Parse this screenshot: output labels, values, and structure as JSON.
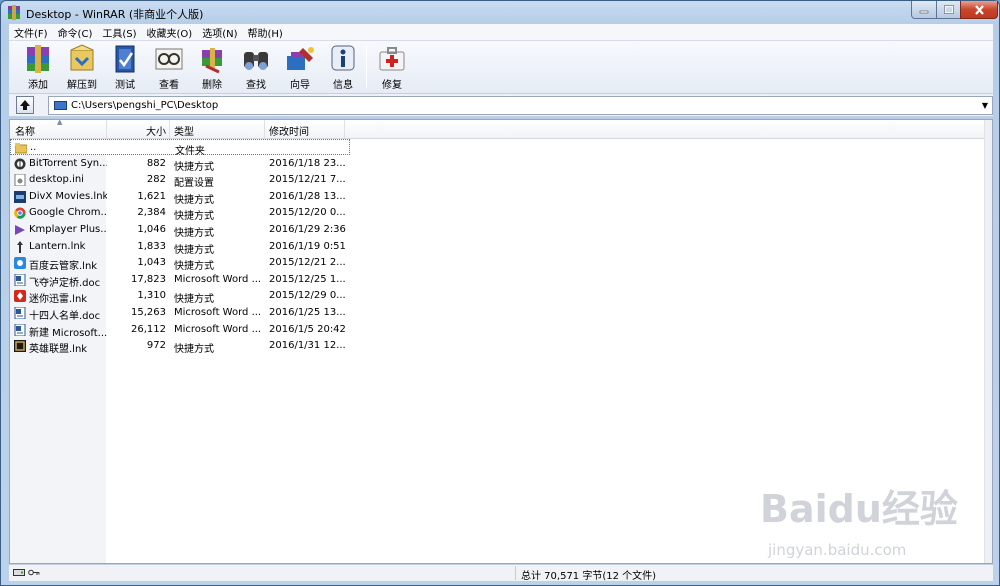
{
  "window": {
    "title": "Desktop - WinRAR (非商业个人版)"
  },
  "menu": [
    "文件(F)",
    "命令(C)",
    "工具(S)",
    "收藏夹(O)",
    "选项(N)",
    "帮助(H)"
  ],
  "toolbar": {
    "buttons": [
      "添加",
      "解压到",
      "测试",
      "查看",
      "删除",
      "查找",
      "向导",
      "信息",
      "修复"
    ]
  },
  "address": {
    "path": "C:\\Users\\pengshi_PC\\Desktop"
  },
  "columns": [
    "名称",
    "大小",
    "类型",
    "修改时间"
  ],
  "files": [
    {
      "name": "..",
      "size": "",
      "type": "文件夹",
      "date": "",
      "icon": "folder-up-icon"
    },
    {
      "name": "BitTorrent Syn...",
      "size": "882",
      "type": "快捷方式",
      "date": "2016/1/18 23...",
      "icon": "bittorrent-icon"
    },
    {
      "name": "desktop.ini",
      "size": "282",
      "type": "配置设置",
      "date": "2015/12/21 7...",
      "icon": "settings-file-icon"
    },
    {
      "name": "DivX Movies.lnk",
      "size": "1,621",
      "type": "快捷方式",
      "date": "2016/1/28 13...",
      "icon": "divx-icon"
    },
    {
      "name": "Google Chrom...",
      "size": "2,384",
      "type": "快捷方式",
      "date": "2015/12/20 0...",
      "icon": "chrome-icon"
    },
    {
      "name": "Kmplayer Plus...",
      "size": "1,046",
      "type": "快捷方式",
      "date": "2016/1/29 2:36",
      "icon": "kmplayer-icon"
    },
    {
      "name": "Lantern.lnk",
      "size": "1,833",
      "type": "快捷方式",
      "date": "2016/1/19 0:51",
      "icon": "lantern-icon"
    },
    {
      "name": "百度云管家.lnk",
      "size": "1,043",
      "type": "快捷方式",
      "date": "2015/12/21 2...",
      "icon": "baidu-cloud-icon"
    },
    {
      "name": "飞夺泸定桥.doc",
      "size": "17,823",
      "type": "Microsoft Word ...",
      "date": "2015/12/25 1...",
      "icon": "word-doc-icon"
    },
    {
      "name": "迷你迅雷.lnk",
      "size": "1,310",
      "type": "快捷方式",
      "date": "2015/12/29 0...",
      "icon": "xunlei-icon"
    },
    {
      "name": "十四人名单.doc",
      "size": "15,263",
      "type": "Microsoft Word ...",
      "date": "2016/1/25 13...",
      "icon": "word-doc-icon"
    },
    {
      "name": "新建 Microsoft...",
      "size": "26,112",
      "type": "Microsoft Word ...",
      "date": "2016/1/5 20:42",
      "icon": "word-doc-icon"
    },
    {
      "name": "英雄联盟.lnk",
      "size": "972",
      "type": "快捷方式",
      "date": "2016/1/31 12...",
      "icon": "lol-icon"
    }
  ],
  "status": {
    "total": "总计 70,571 字节(12 个文件)"
  },
  "watermark": {
    "main": "Baidu经验",
    "sub": "jingyan.baidu.com"
  },
  "colors": {
    "title_bg": "#c9dcf1",
    "close_red": "#c9452c",
    "word_blue": "#2b579a"
  }
}
